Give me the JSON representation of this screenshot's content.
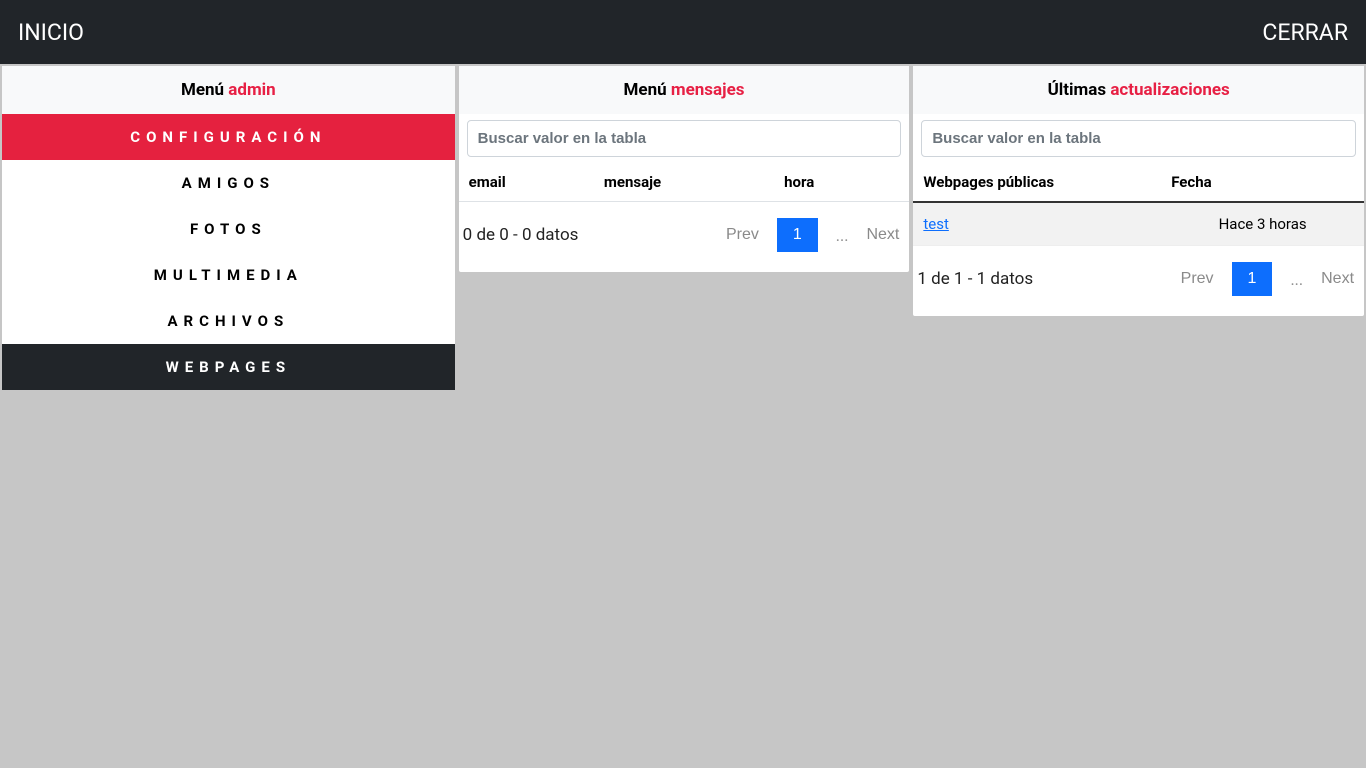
{
  "topbar": {
    "home": "INICIO",
    "close": "CERRAR"
  },
  "sidebar": {
    "title_prefix": "Menú ",
    "title_accent": "admin",
    "items": [
      {
        "label": "CONFIGURACIÓN",
        "state": "active-red"
      },
      {
        "label": "AMIGOS",
        "state": ""
      },
      {
        "label": "FOTOS",
        "state": ""
      },
      {
        "label": "MULTIMEDIA",
        "state": ""
      },
      {
        "label": "ARCHIVOS",
        "state": ""
      },
      {
        "label": "WEBPAGES",
        "state": "active-dark"
      }
    ]
  },
  "messages": {
    "title_prefix": "Menú ",
    "title_accent": "mensajes",
    "search_placeholder": "Buscar valor en la tabla",
    "columns": {
      "c1": "email",
      "c2": "mensaje",
      "c3": "hora"
    },
    "count_text": "0 de 0 - 0 datos",
    "pager": {
      "prev": "Prev",
      "page": "1",
      "dots": "...",
      "next": "Next"
    }
  },
  "updates": {
    "title_prefix": "Últimas ",
    "title_accent": "actualizaciones",
    "search_placeholder": "Buscar valor en la tabla",
    "columns": {
      "c1": "Webpages públicas",
      "c2": "Fecha"
    },
    "rows": [
      {
        "link": "test",
        "date": "Hace 3 horas"
      }
    ],
    "count_text": "1 de 1 - 1 datos",
    "pager": {
      "prev": "Prev",
      "page": "1",
      "dots": "...",
      "next": "Next"
    }
  }
}
